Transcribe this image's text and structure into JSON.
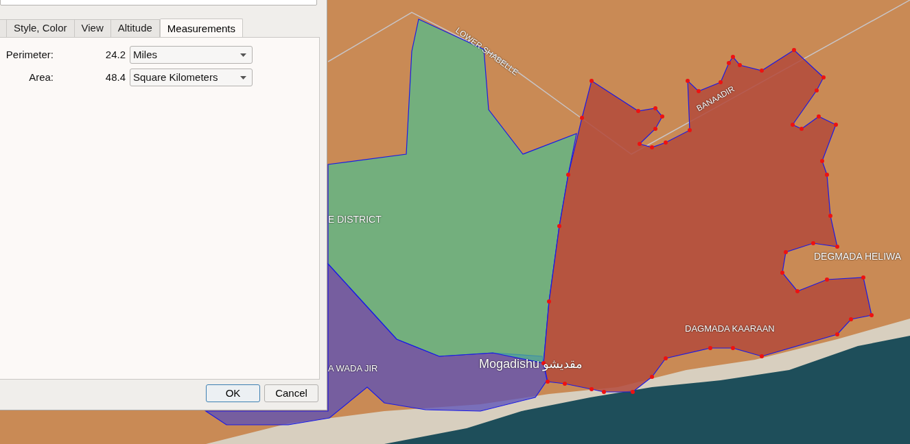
{
  "dialog": {
    "tabs": [
      {
        "label": "Style, Color",
        "selected": false
      },
      {
        "label": "View",
        "selected": false
      },
      {
        "label": "Altitude",
        "selected": false
      },
      {
        "label": "Measurements",
        "selected": true
      }
    ],
    "measurements": [
      {
        "label": "Perimeter:",
        "value": "24.2",
        "unit": "Miles"
      },
      {
        "label": "Area:",
        "value": "48.4",
        "unit": "Square Kilometers"
      }
    ],
    "buttons": [
      {
        "label": "OK",
        "default": true
      },
      {
        "label": "Cancel",
        "default": false
      }
    ]
  },
  "map": {
    "labels": [
      "LOWER SHABELLE",
      "BANAADIR",
      "E DISTRICT",
      "DEGMADA HELIWA",
      "DAGMADA KAARAAN",
      "A WADA JIR",
      "Mogadishu مقديشو"
    ]
  }
}
